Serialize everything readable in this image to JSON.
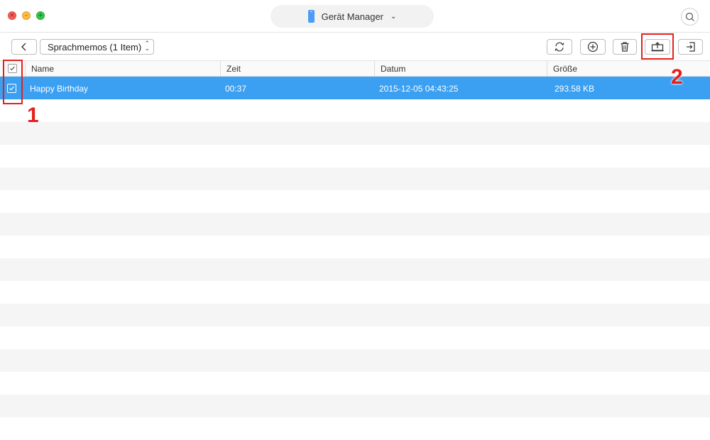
{
  "titlebar": {
    "device_name": "Gerät Manager",
    "dropdown_glyph": "⌄"
  },
  "toolbar": {
    "folder_label": "Sprachmemos (1 Item)",
    "icons": {
      "back": "chevron-left-icon",
      "refresh": "refresh-icon",
      "add": "plus-circle-icon",
      "delete": "trash-icon",
      "export": "export-to-computer-icon",
      "import": "import-icon"
    }
  },
  "table": {
    "columns": [
      "Name",
      "Zeit",
      "Datum",
      "Größe"
    ],
    "rows": [
      {
        "name": "Happy Birthday",
        "zeit": "00:37",
        "datum": "2015-12-05 04:43:25",
        "groesse": "293.58 KB",
        "selected": true
      }
    ]
  },
  "annotations": {
    "marker_1": "1",
    "marker_2": "2"
  },
  "colors": {
    "selection": "#3b9ff2",
    "annotation": "#e5201c",
    "device_icon": "#4a9cf5"
  }
}
